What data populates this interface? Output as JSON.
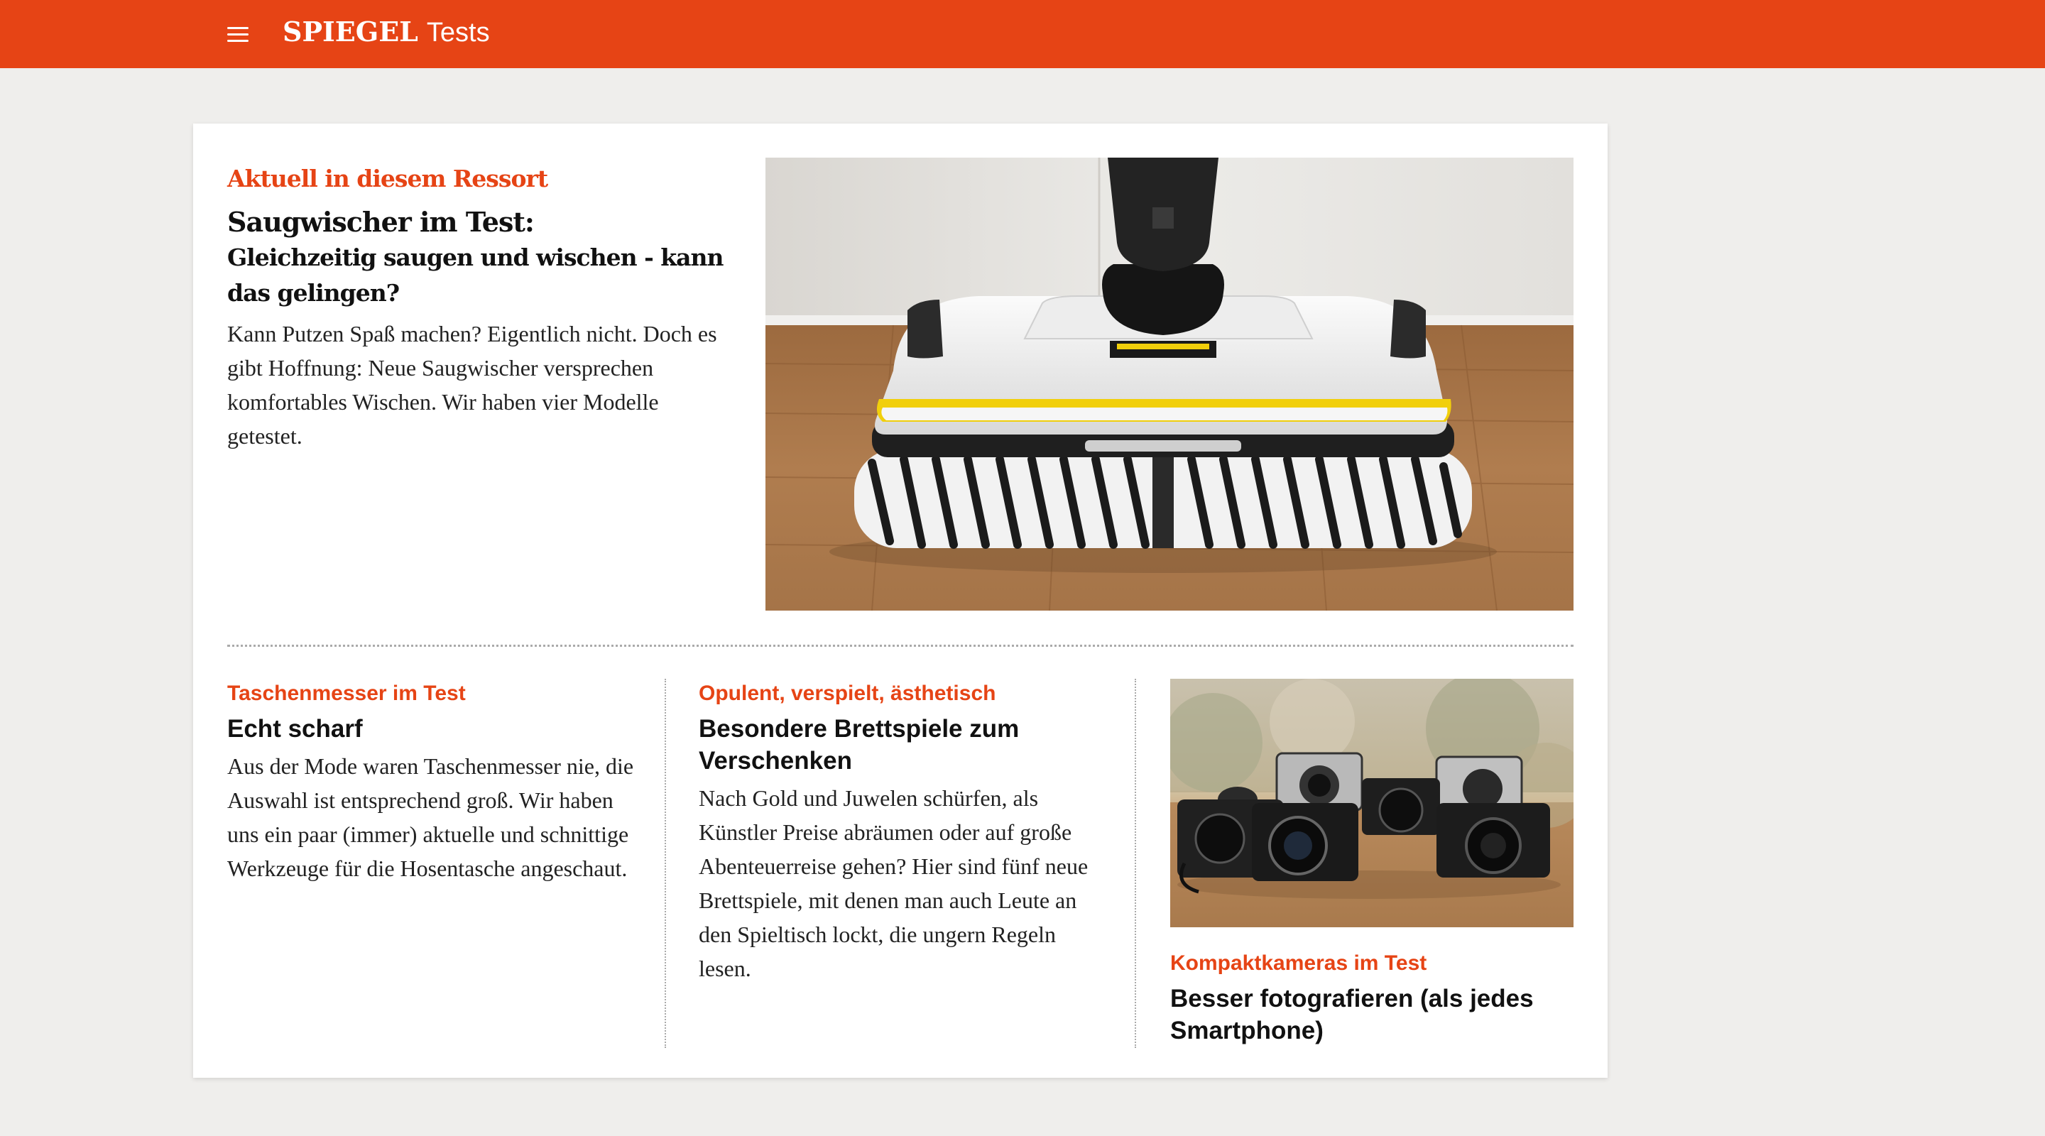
{
  "header": {
    "brand": "SPIEGEL",
    "section": "Tests",
    "menu_icon": "hamburger-menu-icon",
    "accent": "#e64415"
  },
  "hero": {
    "kicker": "Aktuell in diesem Ressort",
    "title": "Saugwischer im Test:",
    "subtitle": "Gleichzeitig saugen und wischen - kann das gelingen?",
    "body": "Kann Putzen Spaß machen? Eigentlich nicht. Doch es gibt Hoffnung: Neue Saugwischer versprechen komfortables Wischen. Wir haben vier Modelle getestet."
  },
  "teasers": [
    {
      "kicker": "Taschenmesser im Test",
      "title": "Echt scharf",
      "body": "Aus der Mode waren Taschenmesser nie, die Auswahl ist entsprechend groß. Wir haben uns ein paar (immer) aktuelle und schnittige Werkzeuge für die Hosentasche angeschaut."
    },
    {
      "kicker": "Opulent, verspielt, ästhetisch",
      "title": "Besondere Brettspiele zum Verschenken",
      "body": "Nach Gold und Juwelen schürfen, als Künstler Preise abräumen oder auf große Abenteuerreise gehen? Hier sind fünf neue Brettspiele, mit denen man auch Leute an den Spieltisch lockt, die ungern Regeln lesen."
    },
    {
      "kicker": "Kompaktkameras im Test",
      "title": "Besser fotografieren (als jedes Smartphone)"
    }
  ]
}
